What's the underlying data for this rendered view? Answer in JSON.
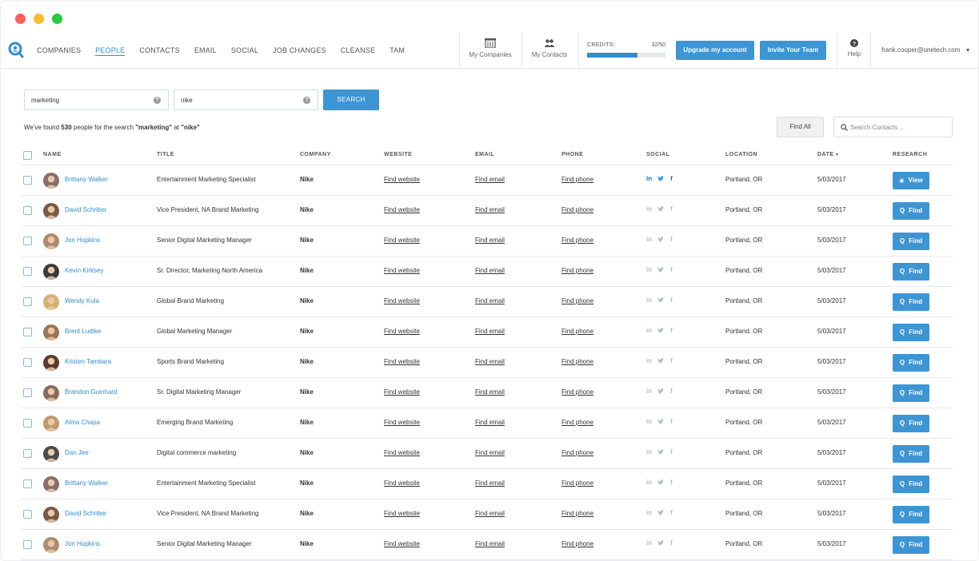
{
  "nav": {
    "links": [
      "COMPANIES",
      "PEOPLE",
      "CONTACTS",
      "EMAIL",
      "SOCIAL",
      "JOB CHANGES",
      "CLEANSE",
      "TAM"
    ],
    "active_index": 1,
    "my_companies": "My Companies",
    "my_contacts": "My Contacts",
    "credits_label": "CREDITS:",
    "credits_value": "32/50",
    "credits_fraction": 0.64,
    "upgrade_label": "Upgrade my account",
    "invite_label": "Invite Your Team",
    "help_label": "Help",
    "user_email": "frank.cooper@onetech.com"
  },
  "search": {
    "keyword": "marketing",
    "company": "nike",
    "button_label": "SEARCH",
    "result_prefix": "We've found ",
    "result_count": "530",
    "result_mid": " people for the search ",
    "result_keyword": "\"marketing\"",
    "result_at": " at ",
    "result_company": "\"nike\"",
    "find_all_label": "Find All",
    "contacts_placeholder": "Search Contacts ..."
  },
  "table": {
    "headers": {
      "name": "NAME",
      "title": "TITLE",
      "company": "COMPANY",
      "website": "WEBSITE",
      "email": "EMAIL",
      "phone": "PHONE",
      "social": "SOCIAL",
      "location": "LOCATION",
      "date": "DATE",
      "research": "RESEARCH"
    },
    "date_sort_icon": "caret-down-icon",
    "rows": [
      {
        "name": "Brittany Walker",
        "title": "Entertainment Marketing Specialist",
        "company": "Nike",
        "website": "Find website",
        "email": "Find email",
        "phone": "Find phone",
        "social_active": true,
        "location": "Portland, OR",
        "date": "5/03/2017",
        "action": "View",
        "avatar_color": "#8a6e6a"
      },
      {
        "name": "David Schriber",
        "title": "Vice President, NA Brand Marketing",
        "company": "Nike",
        "website": "Find website",
        "email": "Find email",
        "phone": "Find phone",
        "social_active": false,
        "location": "Portland, OR",
        "date": "5/03/2017",
        "action": "Find",
        "avatar_color": "#7a5a44"
      },
      {
        "name": "Jon Hopkins",
        "title": "Senior Digital Marketing Manager",
        "company": "Nike",
        "website": "Find website",
        "email": "Find email",
        "phone": "Find phone",
        "social_active": false,
        "location": "Portland, OR",
        "date": "5/03/2017",
        "action": "Find",
        "avatar_color": "#b08a70"
      },
      {
        "name": "Kevin Kirksey",
        "title": "Sr. Director, Marketing North America",
        "company": "Nike",
        "website": "Find website",
        "email": "Find email",
        "phone": "Find phone",
        "social_active": false,
        "location": "Portland, OR",
        "date": "5/03/2017",
        "action": "Find",
        "avatar_color": "#3a3a3a"
      },
      {
        "name": "Wendy Kula",
        "title": "Global Brand Marketing",
        "company": "Nike",
        "website": "Find website",
        "email": "Find email",
        "phone": "Find phone",
        "social_active": false,
        "location": "Portland, OR",
        "date": "5/03/2017",
        "action": "Find",
        "avatar_color": "#d8b070"
      },
      {
        "name": "Brent Ludtke",
        "title": "Global Marketing Manager",
        "company": "Nike",
        "website": "Find website",
        "email": "Find email",
        "phone": "Find phone",
        "social_active": false,
        "location": "Portland, OR",
        "date": "5/03/2017",
        "action": "Find",
        "avatar_color": "#9a7656"
      },
      {
        "name": "Kristen Tambara",
        "title": "Sports Brand Marketing",
        "company": "Nike",
        "website": "Find website",
        "email": "Find email",
        "phone": "Find phone",
        "social_active": false,
        "location": "Portland, OR",
        "date": "5/03/2017",
        "action": "Find",
        "avatar_color": "#5a3a2a"
      },
      {
        "name": "Brandon Guinhard",
        "title": "Sr. Digital Marketing Manager",
        "company": "Nike",
        "website": "Find website",
        "email": "Find email",
        "phone": "Find phone",
        "social_active": false,
        "location": "Portland, OR",
        "date": "5/03/2017",
        "action": "Find",
        "avatar_color": "#8a6a5a"
      },
      {
        "name": "Alma Chapa",
        "title": "Emerging Brand Marketing",
        "company": "Nike",
        "website": "Find website",
        "email": "Find email",
        "phone": "Find phone",
        "social_active": false,
        "location": "Portland, OR",
        "date": "5/03/2017",
        "action": "Find",
        "avatar_color": "#c09a6a"
      },
      {
        "name": "Dan Jee",
        "title": "Digital commerce marketing",
        "company": "Nike",
        "website": "Find website",
        "email": "Find email",
        "phone": "Find phone",
        "social_active": false,
        "location": "Portland, OR",
        "date": "5/03/2017",
        "action": "Find",
        "avatar_color": "#4a4a4a"
      },
      {
        "name": "Brittany Walker",
        "title": "Entertainment Marketing Specialist",
        "company": "Nike",
        "website": "Find website",
        "email": "Find email",
        "phone": "Find phone",
        "social_active": false,
        "location": "Portland, OR",
        "date": "5/03/2017",
        "action": "Find",
        "avatar_color": "#8a6e6a"
      },
      {
        "name": "David Schriber",
        "title": "Vice President, NA Brand Marketing",
        "company": "Nike",
        "website": "Find website",
        "email": "Find email",
        "phone": "Find phone",
        "social_active": false,
        "location": "Portland, OR",
        "date": "5/03/2017",
        "action": "Find",
        "avatar_color": "#7a5a44"
      },
      {
        "name": "Jon Hopkins",
        "title": "Senior Digital Marketing Manager",
        "company": "Nike",
        "website": "Find website",
        "email": "Find email",
        "phone": "Find phone",
        "social_active": false,
        "location": "Portland, OR",
        "date": "5/03/2017",
        "action": "Find",
        "avatar_color": "#b08a70"
      }
    ]
  },
  "colors": {
    "accent": "#3d95d3",
    "link": "#2e8fd1",
    "linkedin_active": "#0e76a8",
    "twitter_active": "#1da1f2",
    "facebook_active": "#3b5998",
    "social_inactive": "#b8bcc0"
  }
}
